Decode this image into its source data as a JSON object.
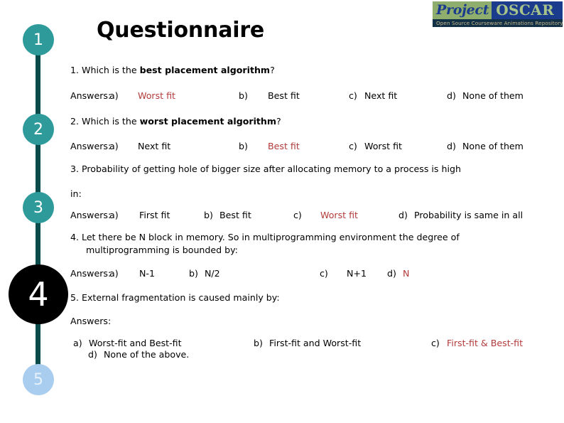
{
  "slide": {
    "title": "Questionnaire",
    "highlight_color": "#B33A3A",
    "timeline_color": "#0A4B4B",
    "node_color": "#2E9A9A",
    "active_node_color": "#000000",
    "last_node_color": "#A8CDEE"
  },
  "logo": {
    "word1": "Project",
    "word2": "OSCAR",
    "tagline": "Open Source Courseware Animations Repository"
  },
  "timeline": {
    "nodes": [
      {
        "label": "1"
      },
      {
        "label": "2"
      },
      {
        "label": "3"
      },
      {
        "label": "4"
      },
      {
        "label": "5"
      }
    ]
  },
  "questions": [
    {
      "number": "1.",
      "text_before": "1. Which is the ",
      "text_bold": "best placement algorithm",
      "text_after": "?",
      "answers_label": "Answers:",
      "options": [
        {
          "marker": "a)",
          "text": "Worst fit",
          "highlight": true
        },
        {
          "marker": "b)",
          "text": "Best fit",
          "highlight": false
        },
        {
          "marker": "c)",
          "text": "Next fit",
          "highlight": false
        },
        {
          "marker": "d)",
          "text": "None of them",
          "highlight": false
        }
      ]
    },
    {
      "number": "2.",
      "text_before": "2. Which is the ",
      "text_bold": "worst placement algorithm",
      "text_after": "?",
      "answers_label": "Answers:",
      "options": [
        {
          "marker": "a)",
          "text": "Next fit",
          "highlight": false
        },
        {
          "marker": "b)",
          "text": "Best fit",
          "highlight": true
        },
        {
          "marker": "c)",
          "text": "Worst fit",
          "highlight": false
        },
        {
          "marker": "d)",
          "text": "None of them",
          "highlight": false
        }
      ]
    },
    {
      "number": "3.",
      "line1": "3. Probability of getting hole of bigger size after allocating memory to a process is high",
      "line2": "in:",
      "answers_label": "Answers:",
      "options": [
        {
          "marker": "a)",
          "text": "First fit",
          "highlight": false
        },
        {
          "marker": "b)",
          "text": "Best fit",
          "highlight": false
        },
        {
          "marker": "c)",
          "text": "Worst fit",
          "highlight": true
        },
        {
          "marker": "d)",
          "text": "Probability is same in all",
          "highlight": false
        }
      ]
    },
    {
      "number": "4.",
      "line1": "4. Let there be N block in memory. So in multiprogramming environment the degree of",
      "line2": "multiprogramming is bounded by:",
      "answers_label": "Answers:",
      "options": [
        {
          "marker": "a)",
          "text": "N-1",
          "highlight": false
        },
        {
          "marker": "b)",
          "text": "N/2",
          "highlight": false
        },
        {
          "marker": "c)",
          "text": "N+1",
          "highlight": false
        },
        {
          "marker": "d)",
          "text": "N",
          "highlight": true
        }
      ]
    },
    {
      "number": "5.",
      "line1": "5. External fragmentation is caused mainly by:",
      "answers_label": "Answers:",
      "options": [
        {
          "marker": "a)",
          "text": "Worst-fit and Best-fit",
          "highlight": false
        },
        {
          "marker": "b)",
          "text": "First-fit and Worst-fit",
          "highlight": false
        },
        {
          "marker": "c)",
          "text": "First-fit & Best-fit",
          "highlight": true
        },
        {
          "marker": "d)",
          "text": "None of the above.",
          "highlight": false
        }
      ]
    }
  ]
}
